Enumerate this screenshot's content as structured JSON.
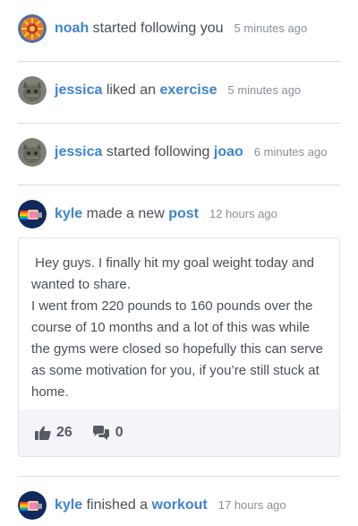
{
  "feed": {
    "items": [
      {
        "user": "noah",
        "verb": " started following you",
        "target": "",
        "time": "5 minutes ago",
        "avatar": "sunburst-avatar"
      },
      {
        "user": "jessica",
        "verb": " liked an ",
        "target": "exercise",
        "time": "5 minutes ago",
        "avatar": "cat-avatar"
      },
      {
        "user": "jessica",
        "verb": " started following ",
        "target": "joao",
        "time": "6 minutes ago",
        "avatar": "cat-avatar"
      },
      {
        "user": "kyle",
        "verb": " made a new ",
        "target": "post",
        "time": "12 hours ago",
        "avatar": "nyan-cat-avatar"
      },
      {
        "user": "kyle",
        "verb": " finished a ",
        "target": "workout",
        "time": "17 hours ago",
        "avatar": "nyan-cat-avatar"
      }
    ],
    "post": {
      "line1": " Hey guys. I finally hit my goal weight today and wanted to share.",
      "line2": "I went from 220 pounds to 160 pounds over the course of 10 months and a lot of this was while the gyms were closed so hopefully this can serve as some motivation for you, if you’re still stuck at home.",
      "likes": "26",
      "comments": "0",
      "like_icon": "thumbs-up-icon",
      "comment_icon": "comments-icon"
    }
  },
  "colors": {
    "accent": "#3f84cf",
    "divider": "#d6dde6",
    "footer_bg": "#f3f5f8"
  }
}
